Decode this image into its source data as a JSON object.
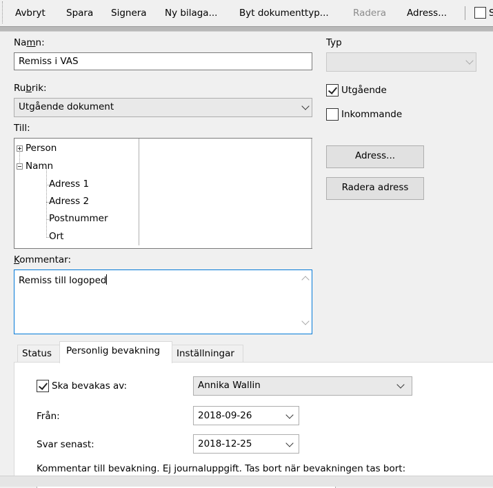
{
  "toolbar": {
    "cancel": "Avbryt",
    "save": "Spara",
    "sign": "Signera",
    "new_attachment": "Ny bilaga...",
    "change_doctype": "Byt dokumenttyp...",
    "delete": "Radera",
    "address": "Adress...",
    "cut_checkbox_label": "S"
  },
  "form": {
    "name_label_pre": "Na",
    "name_label_u": "m",
    "name_label_post": "n:",
    "name_value": "Remiss i VAS",
    "type_label": "Typ",
    "type_value": "",
    "heading_label_pre": "Ru",
    "heading_label_u": "b",
    "heading_label_post": "rik:",
    "heading_value": "Utgående dokument",
    "outgoing_label": "Utgående",
    "outgoing_checked": true,
    "incoming_label": "Inkommande",
    "incoming_checked": false,
    "to_label": "Till:",
    "tree": {
      "person": "Person",
      "name": "Namn",
      "address1": "Adress 1",
      "address2": "Adress 2",
      "postal": "Postnummer",
      "city": "Ort"
    },
    "address_button": "Adress...",
    "delete_address_button": "Radera adress",
    "comment_label_u": "K",
    "comment_label_post": "ommentar:",
    "comment_value": "Remiss till logoped"
  },
  "tabs": {
    "status": "Status",
    "personal_watch": "Personlig bevakning",
    "settings": "Inställningar"
  },
  "watch": {
    "watched_by_label": "Ska bevakas av:",
    "watched_by_checked": true,
    "watched_by_value": "Annika Wallin",
    "from_label": "Från:",
    "from_value": "2018-09-26",
    "reply_label": "Svar senast:",
    "reply_value": "2018-12-25",
    "comment_hint": "Kommentar till bevakning. Ej journaluppgift. Tas bort när bevakningen tas bort:"
  },
  "colors": {
    "window_bg": "#f0f0f0",
    "focus_border": "#0078d7",
    "disabled_text": "#8c8c8c"
  }
}
